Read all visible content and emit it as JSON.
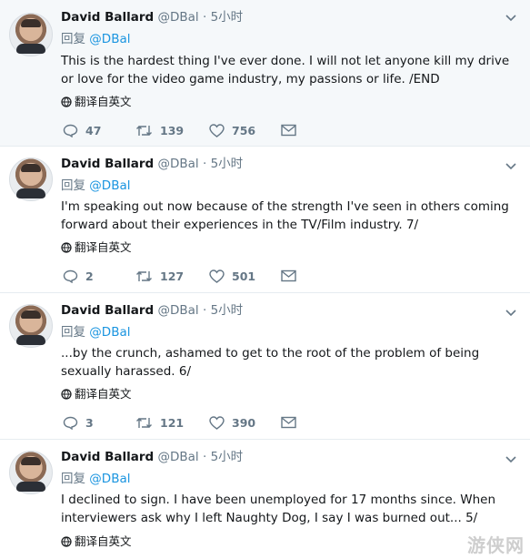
{
  "tweets": [
    {
      "name": "David Ballard",
      "handle": "@DBal",
      "sep": "·",
      "time": "5小时",
      "reply_prefix": "回复",
      "reply_mention": "@DBal",
      "text": "This is the hardest thing I've ever done. I will not let anyone kill my drive or love for the video game industry, my passions or life. /END",
      "translate": "翻译自英文",
      "replies": "47",
      "retweets": "139",
      "likes": "756"
    },
    {
      "name": "David Ballard",
      "handle": "@DBal",
      "sep": "·",
      "time": "5小时",
      "reply_prefix": "回复",
      "reply_mention": "@DBal",
      "text": "I'm speaking out now because of the strength I've seen in others coming forward about their experiences in the TV/Film industry. 7/",
      "translate": "翻译自英文",
      "replies": "2",
      "retweets": "127",
      "likes": "501"
    },
    {
      "name": "David Ballard",
      "handle": "@DBal",
      "sep": "·",
      "time": "5小时",
      "reply_prefix": "回复",
      "reply_mention": "@DBal",
      "text": "...by the crunch, ashamed to get to the root of the problem of being sexually harassed. 6/",
      "translate": "翻译自英文",
      "replies": "3",
      "retweets": "121",
      "likes": "390"
    },
    {
      "name": "David Ballard",
      "handle": "@DBal",
      "sep": "·",
      "time": "5小时",
      "reply_prefix": "回复",
      "reply_mention": "@DBal",
      "text": "I declined to sign. I have been unemployed for 17 months since. When interviewers ask why I left Naughty Dog, I say I was burned out... 5/",
      "translate": "翻译自英文"
    }
  ],
  "watermark": "游侠网",
  "colors": {
    "link": "#1b95e0",
    "muted": "#657786",
    "highlight_bg": "#f5f8fa"
  }
}
